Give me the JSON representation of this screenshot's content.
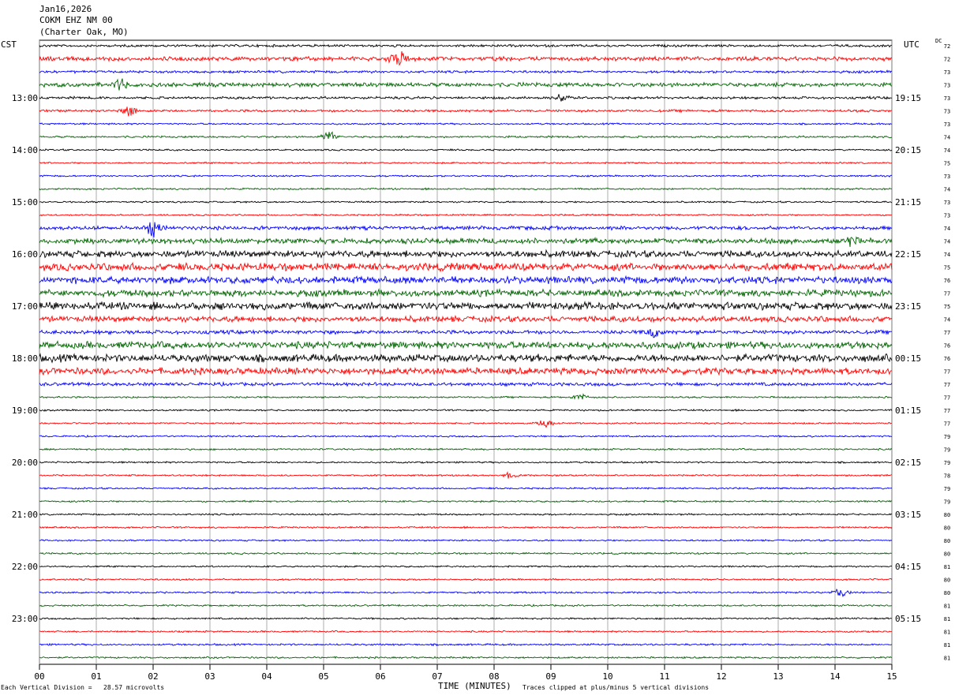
{
  "header": {
    "date": "Jan16,2026",
    "station": "COKM EHZ NM 00",
    "location": "(Charter Oak, MO)"
  },
  "labels": {
    "left_timezone": "CST",
    "right_timezone": "UTC",
    "dc_label": "DC",
    "vertical_division": "Each Vertical Division =   28.57 microvolts",
    "clip_note": "Traces clipped at plus/minus 5 vertical divisions"
  },
  "chart_data": {
    "type": "line",
    "title": "",
    "xlabel": "TIME (MINUTES)",
    "xlim": [
      0,
      15
    ],
    "x_ticks": [
      "00",
      "01",
      "02",
      "03",
      "04",
      "05",
      "06",
      "07",
      "08",
      "09",
      "10",
      "11",
      "12",
      "13",
      "14",
      "15"
    ],
    "grid": true,
    "trace_colors": [
      "#000000",
      "#ff0000",
      "#0000ff",
      "#006400"
    ],
    "left_hour_labels": [
      "13:00",
      "14:00",
      "15:00",
      "16:00",
      "17:00",
      "18:00",
      "19:00",
      "20:00",
      "21:00",
      "22:00",
      "23:00"
    ],
    "right_hour_labels": [
      "19:15",
      "20:15",
      "21:15",
      "22:15",
      "23:15",
      "00:15",
      "01:15",
      "02:15",
      "03:15",
      "04:15",
      "05:15"
    ],
    "dc_offsets": [
      72,
      72,
      73,
      73,
      73,
      73,
      73,
      74,
      74,
      75,
      73,
      74,
      73,
      73,
      74,
      74,
      74,
      75,
      76,
      77,
      75,
      74,
      77,
      76,
      76,
      77,
      77,
      77,
      77,
      77,
      79,
      79,
      79,
      78,
      79,
      79,
      80,
      80,
      80,
      80,
      81,
      80,
      80,
      81,
      81,
      81,
      81,
      81
    ],
    "trace_activity": [
      1.2,
      2.0,
      1.2,
      2.0,
      1.2,
      1.2,
      0.8,
      0.9,
      0.8,
      0.8,
      0.8,
      0.8,
      0.8,
      0.8,
      1.8,
      2.6,
      3.2,
      3.6,
      3.4,
      3.2,
      3.6,
      2.8,
      1.8,
      3.4,
      3.6,
      3.2,
      1.6,
      0.8,
      0.8,
      0.8,
      0.8,
      0.8,
      0.8,
      0.8,
      0.8,
      0.8,
      0.8,
      0.8,
      0.8,
      0.8,
      0.8,
      0.8,
      0.9,
      0.8,
      0.8,
      0.8,
      0.9,
      0.8
    ],
    "events": [
      {
        "trace": 1,
        "minute": 6.3,
        "amp": 10
      },
      {
        "trace": 3,
        "minute": 1.4,
        "amp": 6
      },
      {
        "trace": 4,
        "minute": 9.2,
        "amp": 4
      },
      {
        "trace": 5,
        "minute": 1.6,
        "amp": 5
      },
      {
        "trace": 7,
        "minute": 5.1,
        "amp": 6
      },
      {
        "trace": 14,
        "minute": 2.0,
        "amp": 8
      },
      {
        "trace": 15,
        "minute": 14.3,
        "amp": 5
      },
      {
        "trace": 22,
        "minute": 10.8,
        "amp": 5
      },
      {
        "trace": 27,
        "minute": 9.5,
        "amp": 4
      },
      {
        "trace": 29,
        "minute": 8.9,
        "amp": 4
      },
      {
        "trace": 33,
        "minute": 8.3,
        "amp": 3
      },
      {
        "trace": 42,
        "minute": 14.1,
        "amp": 5
      }
    ]
  }
}
